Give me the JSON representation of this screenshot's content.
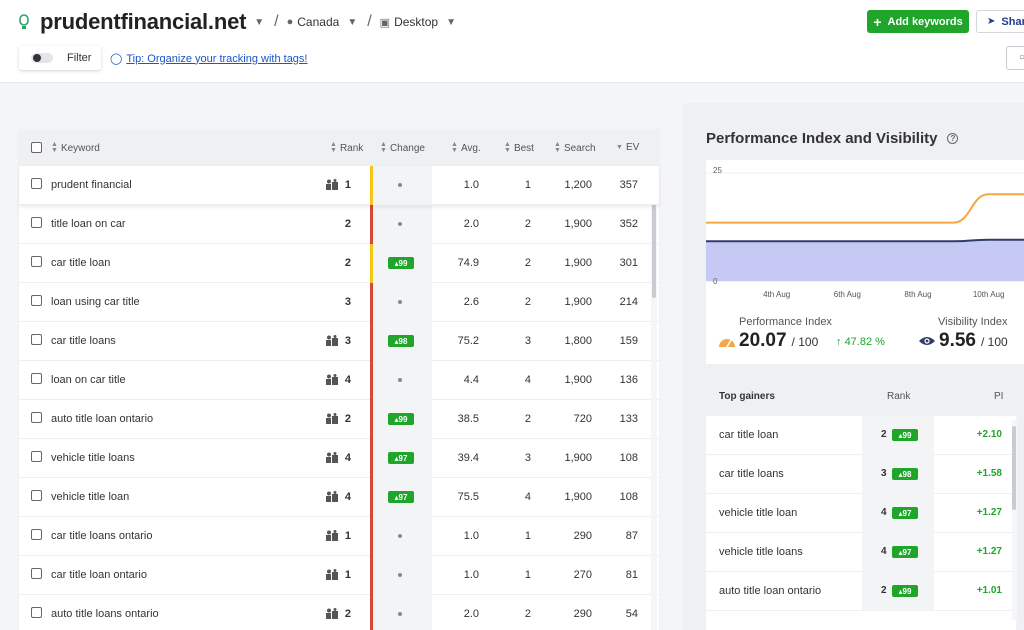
{
  "header": {
    "site_name": "prudentfinancial.net",
    "location": "Canada",
    "device": "Desktop",
    "add_keywords": "Add keywords",
    "share": "Share",
    "filter": "Filter",
    "tip": "Tip: Organize your tracking with tags!"
  },
  "colors": {
    "accent_green": "#1ea52a",
    "link_blue": "#1a56c9",
    "bar_yellow": "#f5c518",
    "bar_red": "#d9473a",
    "pi_line": "#f5a742",
    "visibility_line": "#2f3e66",
    "visibility_fill": "#c7c9f5"
  },
  "table": {
    "columns": [
      "Keyword",
      "Rank",
      "Change",
      "Avg.",
      "Best",
      "Search",
      "EV"
    ],
    "rows": [
      {
        "keyword": "prudent financial",
        "rank": "1",
        "rank_icon": true,
        "change": "",
        "bar": "yellow",
        "avg": "1.0",
        "best": "1",
        "search": "1,200",
        "ev": "357"
      },
      {
        "keyword": "title loan on car",
        "rank": "2",
        "rank_icon": false,
        "change": "",
        "bar": "red",
        "avg": "2.0",
        "best": "2",
        "search": "1,900",
        "ev": "352"
      },
      {
        "keyword": "car title loan",
        "rank": "2",
        "rank_icon": false,
        "change": "99",
        "bar": "yellow",
        "avg": "74.9",
        "best": "2",
        "search": "1,900",
        "ev": "301"
      },
      {
        "keyword": "loan using car title",
        "rank": "3",
        "rank_icon": false,
        "change": "",
        "bar": "red",
        "avg": "2.6",
        "best": "2",
        "search": "1,900",
        "ev": "214"
      },
      {
        "keyword": "car title loans",
        "rank": "3",
        "rank_icon": true,
        "change": "98",
        "bar": "red",
        "avg": "75.2",
        "best": "3",
        "search": "1,800",
        "ev": "159"
      },
      {
        "keyword": "loan on car title",
        "rank": "4",
        "rank_icon": true,
        "change": "",
        "bar": "red",
        "avg": "4.4",
        "best": "4",
        "search": "1,900",
        "ev": "136"
      },
      {
        "keyword": "auto title loan ontario",
        "rank": "2",
        "rank_icon": true,
        "change": "99",
        "bar": "red",
        "avg": "38.5",
        "best": "2",
        "search": "720",
        "ev": "133"
      },
      {
        "keyword": "vehicle title loans",
        "rank": "4",
        "rank_icon": true,
        "change": "97",
        "bar": "red",
        "avg": "39.4",
        "best": "3",
        "search": "1,900",
        "ev": "108"
      },
      {
        "keyword": "vehicle title loan",
        "rank": "4",
        "rank_icon": true,
        "change": "97",
        "bar": "red",
        "avg": "75.5",
        "best": "4",
        "search": "1,900",
        "ev": "108"
      },
      {
        "keyword": "car title loans ontario",
        "rank": "1",
        "rank_icon": true,
        "change": "",
        "bar": "red",
        "avg": "1.0",
        "best": "1",
        "search": "290",
        "ev": "87"
      },
      {
        "keyword": "car title loan ontario",
        "rank": "1",
        "rank_icon": true,
        "change": "",
        "bar": "red",
        "avg": "1.0",
        "best": "1",
        "search": "270",
        "ev": "81"
      },
      {
        "keyword": "auto title loans ontario",
        "rank": "2",
        "rank_icon": true,
        "change": "",
        "bar": "red",
        "avg": "2.0",
        "best": "2",
        "search": "290",
        "ev": "54"
      }
    ]
  },
  "performance": {
    "title": "Performance Index and Visibility",
    "pi_label": "Performance Index",
    "pi_value": "20.07",
    "pi_den": "/ 100",
    "pi_delta": "47.82 %",
    "vi_label": "Visibility Index",
    "vi_value": "9.56",
    "vi_den": "/ 100"
  },
  "chart_data": {
    "type": "line",
    "x": [
      "2nd Aug",
      "3rd Aug",
      "4th Aug",
      "5th Aug",
      "6th Aug",
      "7th Aug",
      "8th Aug",
      "9th Aug",
      "10th Aug",
      "11th Aug"
    ],
    "xticks": [
      "4th Aug",
      "6th Aug",
      "8th Aug",
      "10th Aug"
    ],
    "yticks": [
      "25",
      "0"
    ],
    "ylim": [
      0,
      25
    ],
    "series": [
      {
        "values": [
          13.5,
          13.5,
          13.5,
          13.5,
          13.5,
          13.5,
          13.5,
          13.5,
          20.07,
          20.07
        ]
      },
      {
        "values": [
          9.2,
          9.2,
          9.2,
          9.2,
          9.2,
          9.2,
          9.2,
          9.2,
          9.56,
          9.56
        ]
      }
    ]
  },
  "gainers": {
    "headers": [
      "Top gainers",
      "Rank",
      "PI"
    ],
    "rows": [
      {
        "keyword": "car title loan",
        "rank": "2",
        "change": "99",
        "pi": "+2.10"
      },
      {
        "keyword": "car title loans",
        "rank": "3",
        "change": "98",
        "pi": "+1.58"
      },
      {
        "keyword": "vehicle title loan",
        "rank": "4",
        "change": "97",
        "pi": "+1.27"
      },
      {
        "keyword": "vehicle title loans",
        "rank": "4",
        "change": "97",
        "pi": "+1.27"
      },
      {
        "keyword": "auto title loan ontario",
        "rank": "2",
        "change": "99",
        "pi": "+1.01"
      }
    ]
  }
}
